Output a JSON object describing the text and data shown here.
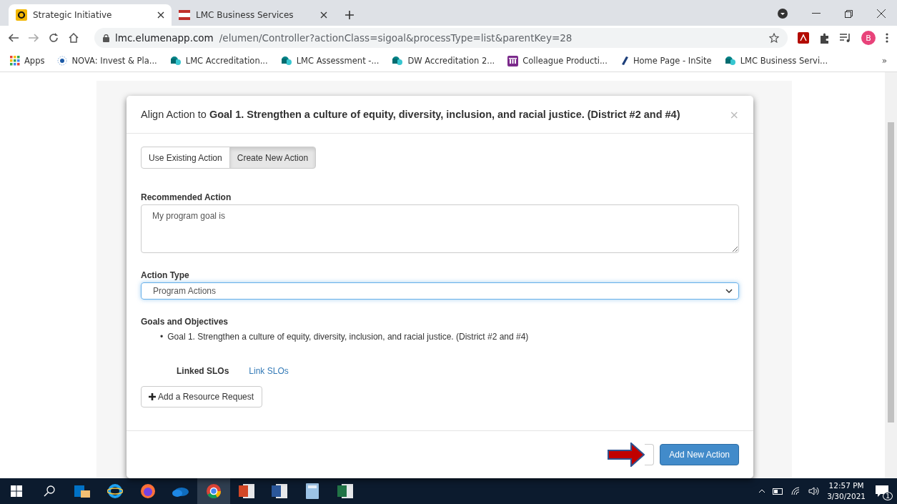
{
  "browser": {
    "tabs": [
      {
        "title": "Strategic Initiative",
        "kind": "elumen",
        "selected": true
      },
      {
        "title": "LMC Business Services",
        "kind": "lmc",
        "selected": false
      }
    ],
    "url": {
      "host": "lmc.elumenapp.com",
      "path": "/elumen/Controller?actionClass=sigoal&processType=list&parentKey=28"
    },
    "profile": "B",
    "bookmarks": [
      {
        "label": "Apps",
        "kind": "apps"
      },
      {
        "label": "NOVA: Invest & Pla...",
        "kind": "nova"
      },
      {
        "label": "LMC Accreditation...",
        "kind": "sharepoint"
      },
      {
        "label": "LMC Assessment -...",
        "kind": "sharepoint"
      },
      {
        "label": "DW Accreditation 2...",
        "kind": "sharepoint"
      },
      {
        "label": "Colleague Producti...",
        "kind": "colleague"
      },
      {
        "label": "Home Page - InSite",
        "kind": "insite"
      },
      {
        "label": "LMC Business Servi...",
        "kind": "sharepoint"
      }
    ],
    "more": "»"
  },
  "modal": {
    "title": "Align Action to **Goal 1. Strengthen a culture of equity, diversity, inclusion, and racial justice. (District #2 and #4)**",
    "close": "×",
    "segments": [
      {
        "label": "Use Existing Action",
        "selected": false
      },
      {
        "label": "Create New Action",
        "selected": true
      }
    ],
    "recommended_action": {
      "label": "Recommended Action",
      "value": "My program goal is"
    },
    "action_type": {
      "label": "Action Type",
      "value": "Program Actions"
    },
    "goals": {
      "heading": "Goals and Objectives",
      "bullet": "•",
      "items": [
        "Goal 1. Strengthen a culture of equity, diversity, inclusion, and racial justice. (District #2 and #4)"
      ]
    },
    "linked_slos": {
      "label": "Linked SLOs",
      "link": "Link SLOs"
    },
    "resource_button": "Add a Resource Request",
    "primary_button": "Add New Action"
  },
  "taskbar": {
    "apps": [
      {
        "kind": "mail",
        "selected": false
      },
      {
        "kind": "ie",
        "selected": false
      },
      {
        "kind": "firefox",
        "selected": false
      },
      {
        "kind": "cloud",
        "selected": false
      },
      {
        "kind": "chrome",
        "selected": true
      },
      {
        "kind": "slides",
        "selected": false
      },
      {
        "kind": "doc",
        "selected": false
      },
      {
        "kind": "calc",
        "selected": false
      },
      {
        "kind": "sheet",
        "selected": false
      }
    ],
    "time": "12:57 PM",
    "date": "3/30/2021",
    "notifications": "1"
  }
}
